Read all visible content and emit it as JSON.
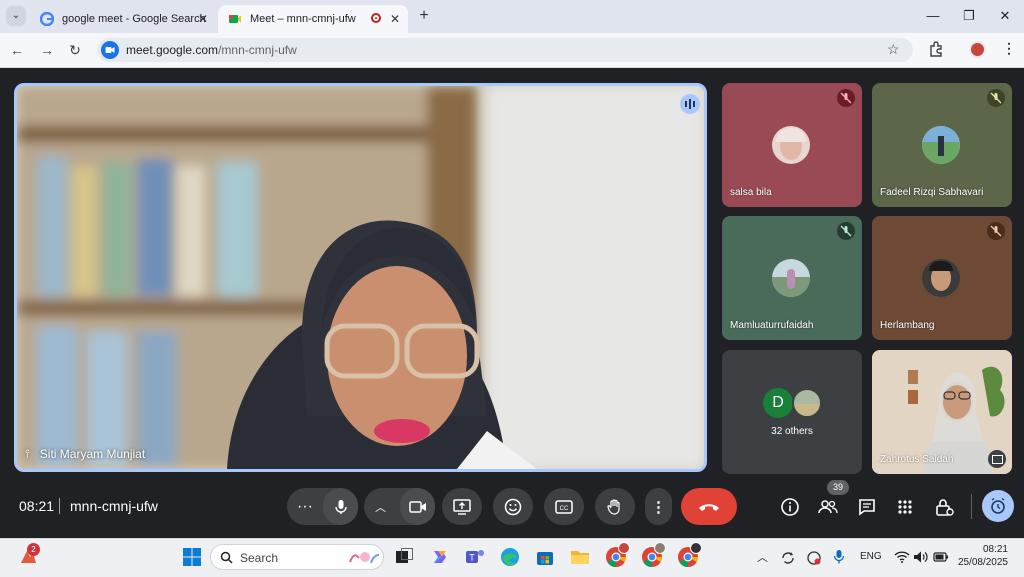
{
  "browser": {
    "tabs": [
      {
        "title": "google meet - Google Search",
        "active": false
      },
      {
        "title": "Meet – mnn-cmnj-ufw",
        "active": true
      }
    ],
    "new_tab_label": "+",
    "url_domain": "meet.google.com",
    "url_path": "/mnn-cmnj-ufw"
  },
  "meeting": {
    "main_speaker": "Siti Maryam Munjiat",
    "participants": [
      {
        "name": "salsa bila",
        "muted": true
      },
      {
        "name": "Fadeel Rizqi Sabhavari",
        "muted": true
      },
      {
        "name": "Mamluaturrufaidah",
        "muted": true
      },
      {
        "name": "Herlambang",
        "muted": true
      },
      {
        "name": "Zahrotus Saidah",
        "muted": false
      }
    ],
    "others_label": "32 others",
    "others_initial": "D",
    "time": "08:21",
    "code": "mnn-cmnj-ufw",
    "participant_count": "39"
  },
  "taskbar": {
    "search_placeholder": "Search",
    "notification_badge": "2",
    "language": "ENG",
    "clock_time": "08:21",
    "clock_date": "25/08/2025"
  },
  "colors": {
    "accent": "#a8c7fa",
    "end_call": "#e04336",
    "meet_bg": "#202124",
    "tile_bg": "#3c4043"
  }
}
